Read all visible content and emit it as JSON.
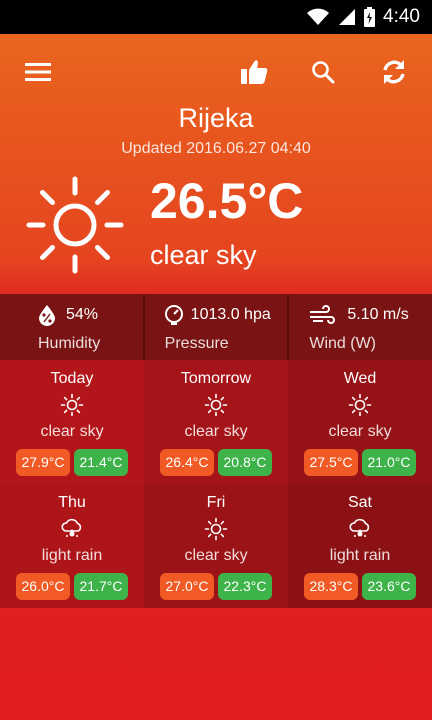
{
  "status_bar": {
    "time": "4:40"
  },
  "location": {
    "city": "Rijeka",
    "updated": "Updated 2016.06.27 04:40"
  },
  "current": {
    "temperature": "26.5°C",
    "condition": "clear sky",
    "icon": "sun-icon"
  },
  "details": [
    {
      "icon": "humidity-icon",
      "value": "54%",
      "label": "Humidity"
    },
    {
      "icon": "pressure-gauge-icon",
      "value": "1013.0 hpa",
      "label": "Pressure"
    },
    {
      "icon": "wind-icon",
      "value": "5.10 m/s",
      "label": "Wind (W)"
    }
  ],
  "forecast": [
    {
      "day": "Today",
      "icon": "sun-icon",
      "condition": "clear sky",
      "high": "27.9°C",
      "low": "21.4°C",
      "bg": "#b3161a"
    },
    {
      "day": "Tomorrow",
      "icon": "sun-icon",
      "condition": "clear sky",
      "high": "26.4°C",
      "low": "20.8°C",
      "bg": "#a51419"
    },
    {
      "day": "Wed",
      "icon": "sun-icon",
      "condition": "clear sky",
      "high": "27.5°C",
      "low": "21.0°C",
      "bg": "#951216"
    },
    {
      "day": "Thu",
      "icon": "rain-cloud-icon",
      "condition": "light rain",
      "high": "26.0°C",
      "low": "21.7°C",
      "bg": "#ad1519"
    },
    {
      "day": "Fri",
      "icon": "sun-icon",
      "condition": "clear sky",
      "high": "27.0°C",
      "low": "22.3°C",
      "bg": "#9b1317"
    },
    {
      "day": "Sat",
      "icon": "rain-cloud-icon",
      "condition": "light rain",
      "high": "28.3°C",
      "low": "23.6°C",
      "bg": "#8c1114"
    }
  ],
  "colors": {
    "high_pill": "#f15a24",
    "low_pill": "#3db34a",
    "details_bg": "#7a1414"
  }
}
